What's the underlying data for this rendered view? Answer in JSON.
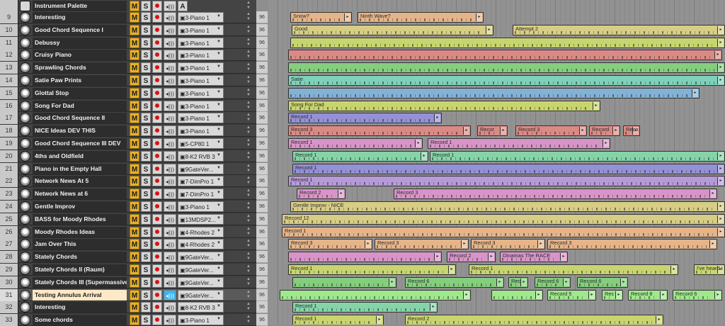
{
  "colors": {
    "orange": "#e5b489",
    "yellow": "#d7cd85",
    "lime": "#c8d56f",
    "red": "#da8a85",
    "green": "#85ce7e",
    "teal": "#7fd1b9",
    "blue": "#82b2d6",
    "purple": "#9591d6",
    "violet": "#b69ad8",
    "pink": "#d894c8",
    "mint": "#85d4a8",
    "brightgreen": "#9fe88c"
  },
  "header": {
    "folder_icon": "folder-icon",
    "title": "Instrument Palette",
    "mute": "M",
    "solo": "S",
    "monitor": "◂)))",
    "auto": "A"
  },
  "tracks": [
    {
      "num": "9",
      "name": "Interesting",
      "instrument": "3-Piano 1",
      "vel": "96"
    },
    {
      "num": "10",
      "name": "Good Chord Sequence I",
      "instrument": "3-Piano 1",
      "vel": "96"
    },
    {
      "num": "11",
      "name": "Debussy",
      "instrument": "3-Piano 1",
      "vel": "96"
    },
    {
      "num": "12",
      "name": "Cruisy Piano",
      "instrument": "3-Piano 1",
      "vel": "96"
    },
    {
      "num": "13",
      "name": "Sprawling Chords",
      "instrument": "3-Piano 1",
      "vel": "96"
    },
    {
      "num": "14",
      "name": "Satie Paw Prints",
      "instrument": "3-Piano 1",
      "vel": "96"
    },
    {
      "num": "15",
      "name": "Glottal Stop",
      "instrument": "3-Piano 1",
      "vel": "96"
    },
    {
      "num": "16",
      "name": "Song For Dad",
      "instrument": "3-Piano 1",
      "vel": "96"
    },
    {
      "num": "17",
      "name": "Good Chord Sequence II",
      "instrument": "3-Piano 1",
      "vel": "96"
    },
    {
      "num": "18",
      "name": "NICE Ideas DEV THIS",
      "instrument": "3-Piano 1",
      "vel": "96"
    },
    {
      "num": "19",
      "name": "Good Chord Sequence III DEV",
      "instrument": "5-CP80 1",
      "vel": "96"
    },
    {
      "num": "20",
      "name": "4ths and Oldfield",
      "instrument": "8-K2 RVB 3",
      "vel": "96"
    },
    {
      "num": "21",
      "name": "Piano in the Empty Hall",
      "instrument": "9GateVer...",
      "vel": "96"
    },
    {
      "num": "22",
      "name": "Network News At 5",
      "instrument": "7-DimPro 1",
      "vel": "96"
    },
    {
      "num": "23",
      "name": "Network News at 6",
      "instrument": "7-DimPro 1",
      "vel": "96"
    },
    {
      "num": "24",
      "name": "Gentle Improv",
      "instrument": "3-Piano 1",
      "vel": "96"
    },
    {
      "num": "25",
      "name": "BASS for Moody Rhodes",
      "instrument": "13MDSP2...",
      "vel": "96"
    },
    {
      "num": "26",
      "name": "Moody Rhodes Ideas",
      "instrument": "4-Rhodes 2",
      "vel": "96"
    },
    {
      "num": "27",
      "name": "Jam Over This",
      "instrument": "4-Rhodes 2",
      "vel": "96"
    },
    {
      "num": "28",
      "name": "Stately Chords",
      "instrument": "9GateVer...",
      "vel": "96"
    },
    {
      "num": "29",
      "name": "Stately Chords II (Raum)",
      "instrument": "9GateVer...",
      "vel": "96"
    },
    {
      "num": "30",
      "name": "Stately Chords III (Supermassive)",
      "instrument": "9GateVer...",
      "vel": "96"
    },
    {
      "num": "31",
      "name": "Testing Annulus Arrival",
      "instrument": "9GateVer...",
      "vel": "96",
      "selected": true
    },
    {
      "num": "32",
      "name": "Interesting",
      "instrument": "8-K2 RVB 3",
      "vel": "96"
    },
    {
      "num": "33",
      "name": "Some chords",
      "instrument": "3-Piano 1",
      "vel": "96"
    }
  ],
  "clips": [
    {
      "row": 0,
      "start": 410,
      "end": 497,
      "label": "Snow?",
      "color": "orange"
    },
    {
      "row": 0,
      "start": 505,
      "end": 683,
      "label": "Ninth Wave?",
      "color": "orange"
    },
    {
      "row": 1,
      "start": 412,
      "end": 697,
      "label": "Good",
      "color": "yellow"
    },
    {
      "row": 1,
      "start": 724,
      "end": 1024,
      "label": "Attempt 2",
      "color": "yellow"
    },
    {
      "row": 2,
      "start": 410,
      "end": 1024,
      "label": "",
      "color": "lime"
    },
    {
      "row": 3,
      "start": 407,
      "end": 1020,
      "label": "",
      "color": "red"
    },
    {
      "row": 4,
      "start": 407,
      "end": 1024,
      "label": "",
      "color": "green"
    },
    {
      "row": 5,
      "start": 407,
      "end": 1024,
      "label": "Satie",
      "color": "teal"
    },
    {
      "row": 6,
      "start": 407,
      "end": 988,
      "label": "",
      "color": "blue"
    },
    {
      "row": 7,
      "start": 407,
      "end": 848,
      "label": "Song For Dad",
      "color": "lime"
    },
    {
      "row": 8,
      "start": 407,
      "end": 624,
      "label": "Record 1",
      "color": "purple"
    },
    {
      "row": 9,
      "start": 407,
      "end": 665,
      "label": "Record 3",
      "color": "red"
    },
    {
      "row": 9,
      "start": 674,
      "end": 717,
      "label": "Recor",
      "color": "red"
    },
    {
      "row": 9,
      "start": 728,
      "end": 829,
      "label": "Record 3",
      "color": "red"
    },
    {
      "row": 9,
      "start": 832,
      "end": 876,
      "label": "Record",
      "color": "red"
    },
    {
      "row": 9,
      "start": 880,
      "end": 904,
      "label": "Reco",
      "color": "red"
    },
    {
      "row": 10,
      "start": 407,
      "end": 597,
      "label": "Record 1",
      "color": "pink"
    },
    {
      "row": 10,
      "start": 604,
      "end": 862,
      "label": "Record 1",
      "color": "pink"
    },
    {
      "row": 11,
      "start": 413,
      "end": 605,
      "label": "Record 1",
      "color": "mint"
    },
    {
      "row": 11,
      "start": 607,
      "end": 1024,
      "label": "Record 1",
      "color": "mint"
    },
    {
      "row": 12,
      "start": 413,
      "end": 1024,
      "label": "Record 1",
      "color": "purple"
    },
    {
      "row": 13,
      "start": 407,
      "end": 1024,
      "label": "Record 1",
      "color": "violet"
    },
    {
      "row": 14,
      "start": 419,
      "end": 488,
      "label": "Record 2",
      "color": "pink"
    },
    {
      "row": 14,
      "start": 556,
      "end": 1013,
      "label": "Record 3",
      "color": "pink"
    },
    {
      "row": 15,
      "start": 410,
      "end": 1024,
      "label": "Gentle Improv - NICE",
      "color": "yellow"
    },
    {
      "row": 16,
      "start": 398,
      "end": 1024,
      "label": "Record 12",
      "color": "yellow"
    },
    {
      "row": 17,
      "start": 398,
      "end": 1024,
      "label": "Record 1",
      "color": "orange"
    },
    {
      "row": 18,
      "start": 407,
      "end": 526,
      "label": "Record 3",
      "color": "orange"
    },
    {
      "row": 18,
      "start": 529,
      "end": 662,
      "label": "Record 3",
      "color": "orange"
    },
    {
      "row": 18,
      "start": 665,
      "end": 770,
      "label": "Record 3",
      "color": "orange"
    },
    {
      "row": 18,
      "start": 773,
      "end": 1013,
      "label": "Record 3",
      "color": "orange"
    },
    {
      "row": 19,
      "start": 407,
      "end": 624,
      "label": "",
      "color": "pink"
    },
    {
      "row": 19,
      "start": 631,
      "end": 700,
      "label": "Record 2",
      "color": "pink"
    },
    {
      "row": 19,
      "start": 706,
      "end": 802,
      "label": "Dinamas The RACE",
      "color": "pink"
    },
    {
      "row": 20,
      "start": 407,
      "end": 644,
      "label": "Record 1",
      "color": "lime"
    },
    {
      "row": 20,
      "start": 662,
      "end": 958,
      "label": "Record 1",
      "color": "lime"
    },
    {
      "row": 20,
      "start": 980,
      "end": 1024,
      "label": "I've heard t",
      "color": "lime"
    },
    {
      "row": 21,
      "start": 413,
      "end": 560,
      "label": "",
      "color": "green"
    },
    {
      "row": 21,
      "start": 572,
      "end": 712,
      "label": "Record 6",
      "color": "green"
    },
    {
      "row": 21,
      "start": 718,
      "end": 746,
      "label": "Rec",
      "color": "green"
    },
    {
      "row": 21,
      "start": 755,
      "end": 806,
      "label": "Record 6",
      "color": "green"
    },
    {
      "row": 21,
      "start": 815,
      "end": 887,
      "label": "Record 6",
      "color": "green"
    },
    {
      "row": 22,
      "start": 395,
      "end": 665,
      "label": "",
      "color": "brightgreen"
    },
    {
      "row": 22,
      "start": 694,
      "end": 767,
      "label": "",
      "color": "brightgreen"
    },
    {
      "row": 22,
      "start": 773,
      "end": 842,
      "label": "Record 5",
      "color": "brightgreen"
    },
    {
      "row": 22,
      "start": 850,
      "end": 880,
      "label": "Rec",
      "color": "brightgreen"
    },
    {
      "row": 22,
      "start": 887,
      "end": 943,
      "label": "Record 8",
      "color": "brightgreen"
    },
    {
      "row": 22,
      "start": 950,
      "end": 1020,
      "label": "Record 6",
      "color": "brightgreen"
    },
    {
      "row": 23,
      "start": 413,
      "end": 618,
      "label": "Record 1",
      "color": "mint"
    },
    {
      "row": 24,
      "start": 413,
      "end": 542,
      "label": "Record 1",
      "color": "lime"
    },
    {
      "row": 24,
      "start": 572,
      "end": 937,
      "label": "Record 2",
      "color": "lime"
    }
  ]
}
